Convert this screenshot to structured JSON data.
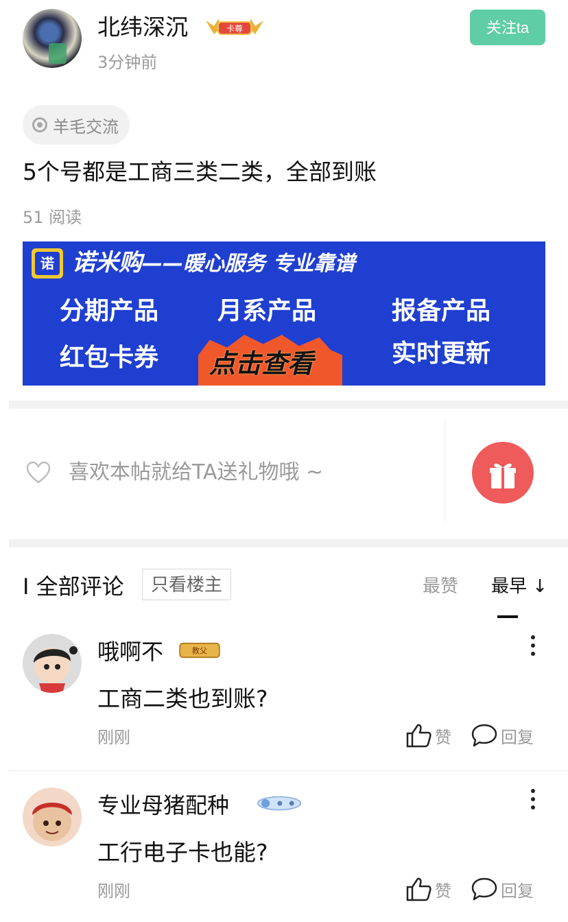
{
  "post": {
    "author": "北纬深沉",
    "author_badge": "卡尊",
    "time": "3分钟前",
    "follow_label": "关注ta",
    "topic_tag": "羊毛交流",
    "content": "5个号都是工商三类二类，全部到账",
    "read_count": "51 阅读"
  },
  "banner": {
    "logo": "诺",
    "title": "诺米购",
    "tagline": "——暖心服务 专业靠谱",
    "items": [
      "分期产品",
      "月系产品",
      "报备产品",
      "红包卡券",
      "实时更新"
    ],
    "cta": "点击查看"
  },
  "gift": {
    "prompt": "喜欢本帖就给TA送礼物哦 ~"
  },
  "comments_header": {
    "title": "I 全部评论",
    "op_only": "只看楼主",
    "sort_likes": "最赞",
    "sort_earliest": "最早 ↓"
  },
  "comments": [
    {
      "name": "哦啊不",
      "badge": "教父",
      "text": "工商二类也到账?",
      "time": "刚刚",
      "like_label": "赞",
      "reply_label": "回复"
    },
    {
      "name": "专业母猪配种",
      "badge": "",
      "text": "工行电子卡也能?",
      "time": "刚刚",
      "like_label": "赞",
      "reply_label": "回复"
    }
  ],
  "colors": {
    "follow_bg": "#5fcda5",
    "banner_bg": "#1f3fd0",
    "gift_bg": "#ef5a5a"
  }
}
